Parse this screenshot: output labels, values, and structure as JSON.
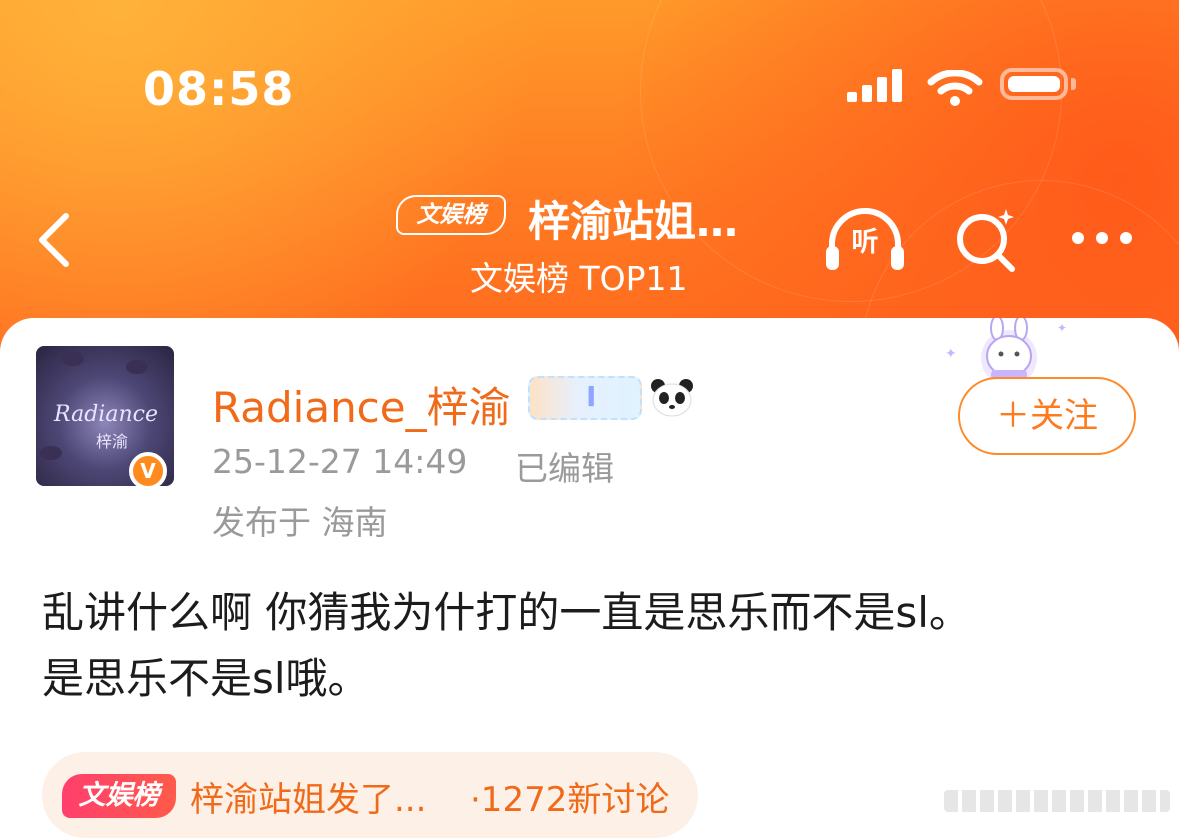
{
  "status_bar": {
    "time": "08:58",
    "signal_icon": "cellular-signal-icon",
    "wifi_icon": "wifi-icon",
    "battery_icon": "battery-icon"
  },
  "nav": {
    "back_icon": "chevron-left-icon",
    "topic_badge": "文娱榜",
    "title": "梓渝站姐…",
    "subtitle": "文娱榜 TOP11",
    "listen_label": "听",
    "search_icon": "search-icon",
    "more_icon": "more-dots-icon"
  },
  "post": {
    "avatar_text": "Radiance",
    "avatar_sub": "梓渝",
    "verified_label": "V",
    "username": "Radiance_梓渝",
    "follow_label": "＋关注",
    "timestamp": "25-12-27 14:49",
    "edited": "已编辑",
    "location": "发布于 海南",
    "content_lines": [
      "乱讲什么啊 你猜我为什打的一直是思乐而不是sl。",
      "是思乐不是sl哦。"
    ]
  },
  "topic": {
    "tag": "文娱榜",
    "title": "梓渝站姐发了...",
    "count": "·1272新讨论"
  },
  "colors": {
    "brand_orange": "#ff7a22",
    "username_orange": "#f06a1a",
    "meta_gray": "#9a9a9a",
    "topic_tag_red": "#ff3f6d"
  }
}
